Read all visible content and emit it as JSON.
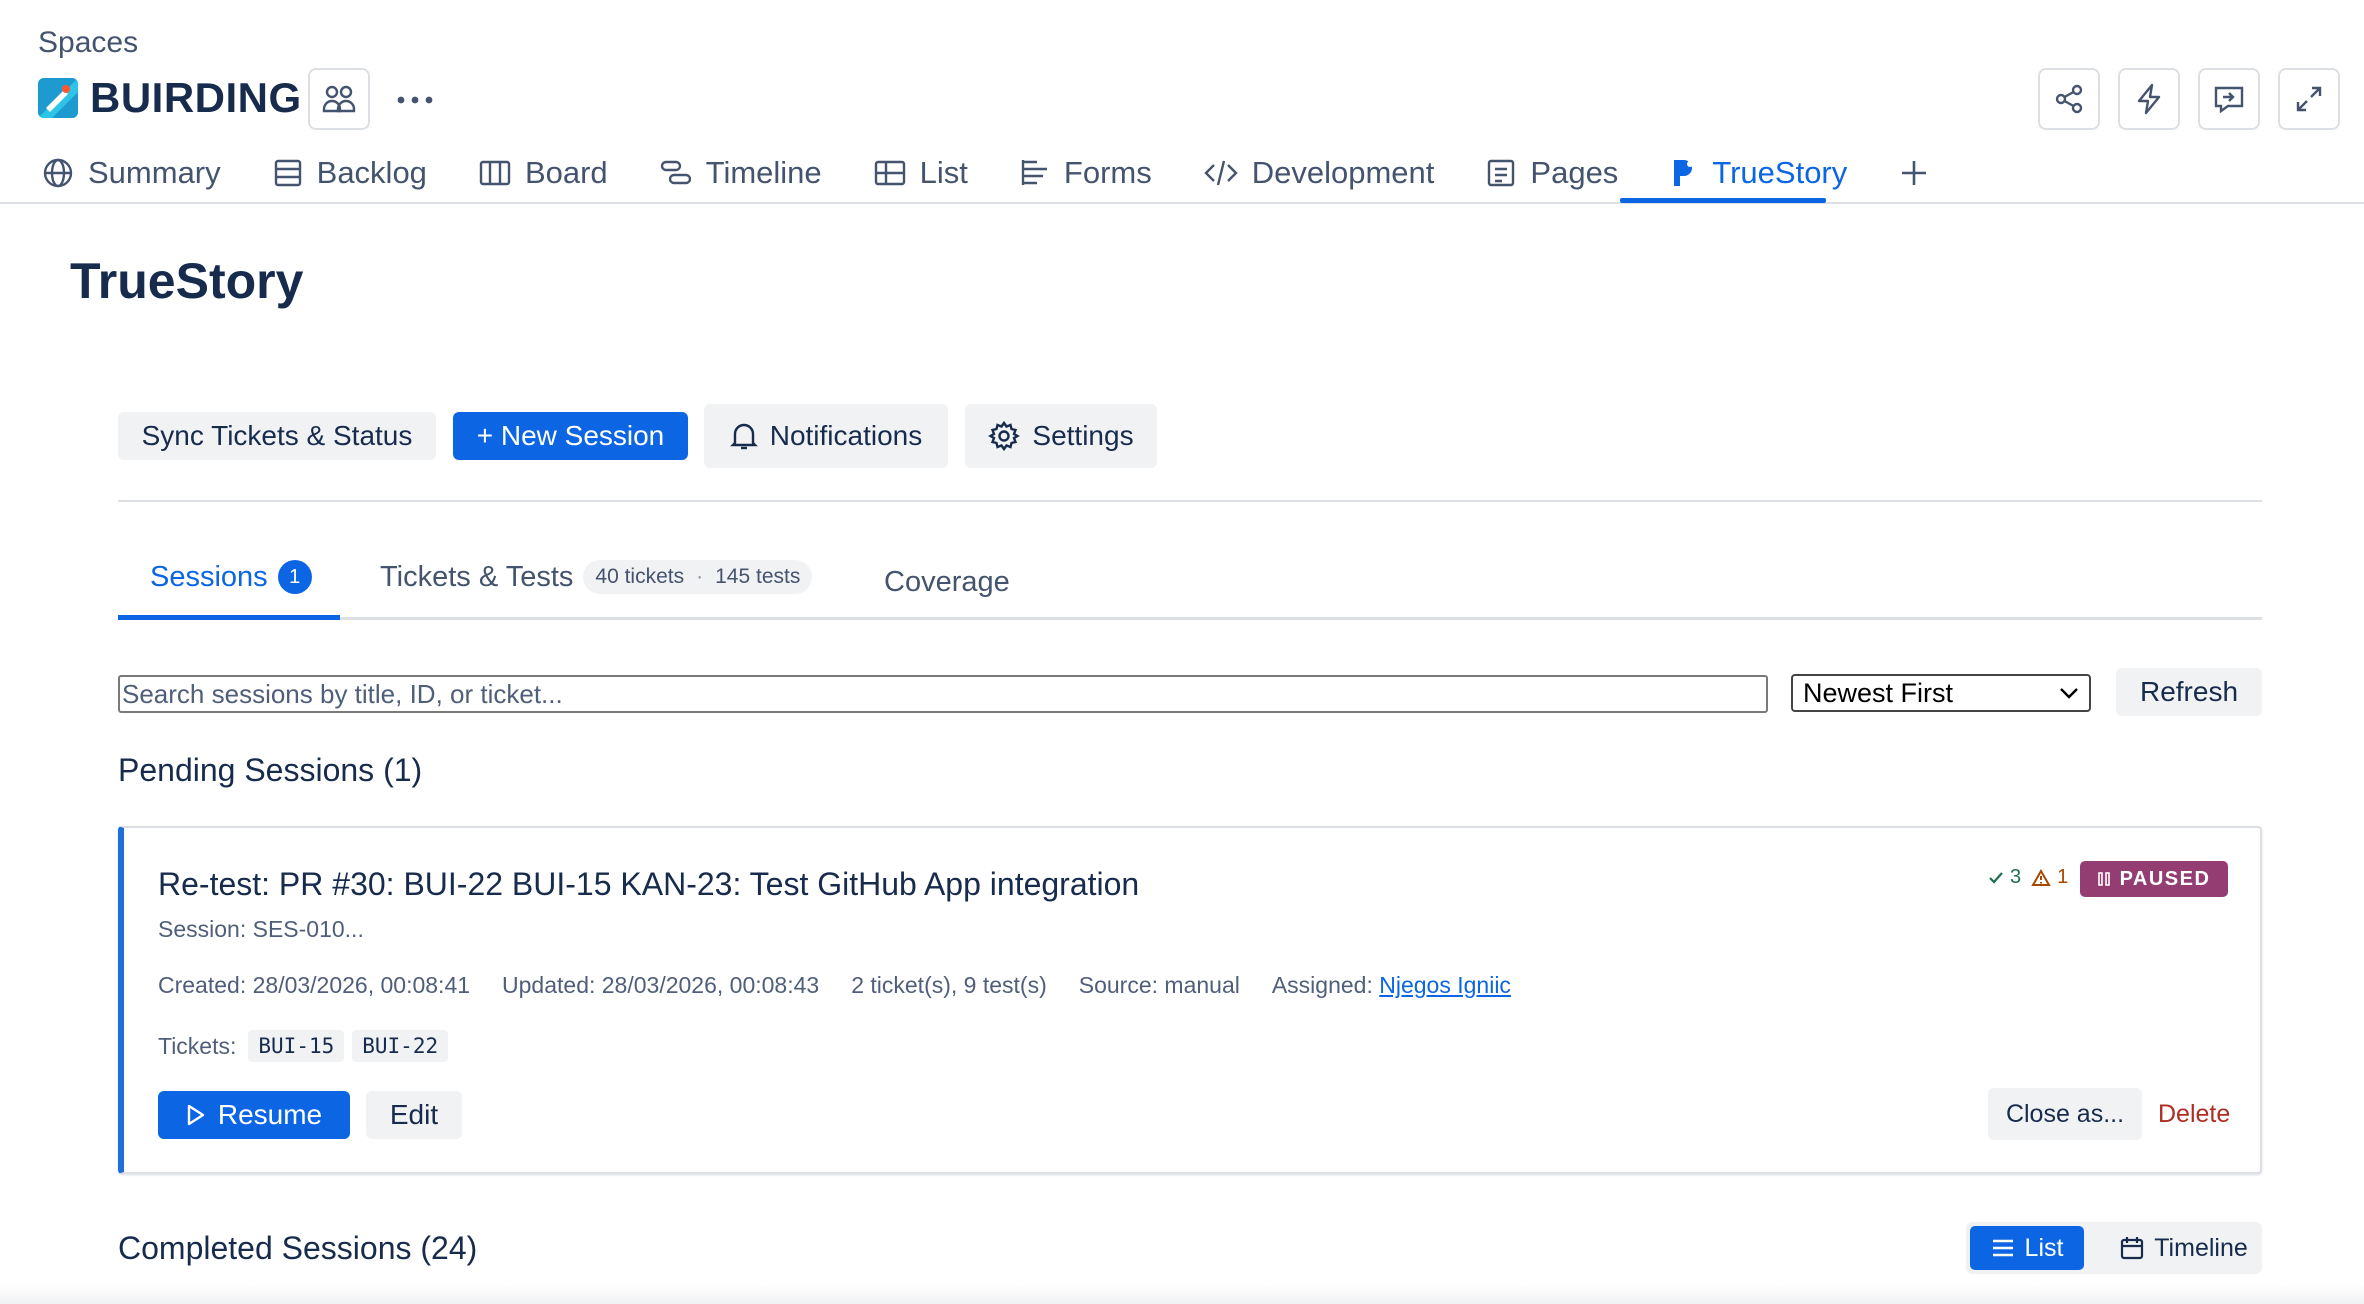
{
  "header": {
    "breadcrumb": "Spaces",
    "project_name": "BUIRDING"
  },
  "nav": {
    "items": [
      {
        "label": "Summary",
        "icon": "globe-icon"
      },
      {
        "label": "Backlog",
        "icon": "backlog-icon"
      },
      {
        "label": "Board",
        "icon": "board-icon"
      },
      {
        "label": "Timeline",
        "icon": "timeline-icon"
      },
      {
        "label": "List",
        "icon": "list-icon"
      },
      {
        "label": "Forms",
        "icon": "forms-icon"
      },
      {
        "label": "Development",
        "icon": "code-icon"
      },
      {
        "label": "Pages",
        "icon": "pages-icon"
      },
      {
        "label": "TrueStory",
        "icon": "truestory-icon",
        "active": true
      }
    ]
  },
  "page": {
    "title": "TrueStory"
  },
  "toolbar": {
    "sync_label": "Sync Tickets & Status",
    "new_session_label": "+ New Session",
    "notifications_label": "Notifications",
    "settings_label": "Settings"
  },
  "tabs": {
    "sessions_label": "Sessions",
    "sessions_count": "1",
    "tickets_label": "Tickets & Tests",
    "tickets_count": "40 tickets",
    "separator": "·",
    "tests_count": "145 tests",
    "coverage_label": "Coverage"
  },
  "search": {
    "placeholder": "Search sessions by title, ID, or ticket...",
    "sort_selected": "Newest First",
    "refresh_label": "Refresh"
  },
  "pending": {
    "heading": "Pending Sessions (1)",
    "session": {
      "title": "Re-test: PR #30: BUI-22 BUI-15 KAN-23: Test GitHub App integration",
      "session_id": "Session: SES-010...",
      "created": "Created: 28/03/2026, 00:08:41",
      "updated": "Updated: 28/03/2026, 00:08:43",
      "counts": "2 ticket(s), 9 test(s)",
      "source": "Source: manual",
      "assigned_label": "Assigned:",
      "assigned_name": "Njegos Igniic",
      "tickets_label": "Tickets:",
      "tickets": [
        "BUI-15",
        "BUI-22"
      ],
      "passed_count": "3",
      "warning_count": "1",
      "status": "PAUSED",
      "status_color": "#943d73",
      "resume_label": "Resume",
      "edit_label": "Edit",
      "close_label": "Close as...",
      "delete_label": "Delete"
    }
  },
  "completed": {
    "heading": "Completed Sessions (24)",
    "view_list_label": "List",
    "view_timeline_label": "Timeline"
  },
  "colors": {
    "accent": "#0c66e4",
    "danger": "#ae2e24",
    "success": "#216e4e",
    "warning": "#a54800"
  }
}
